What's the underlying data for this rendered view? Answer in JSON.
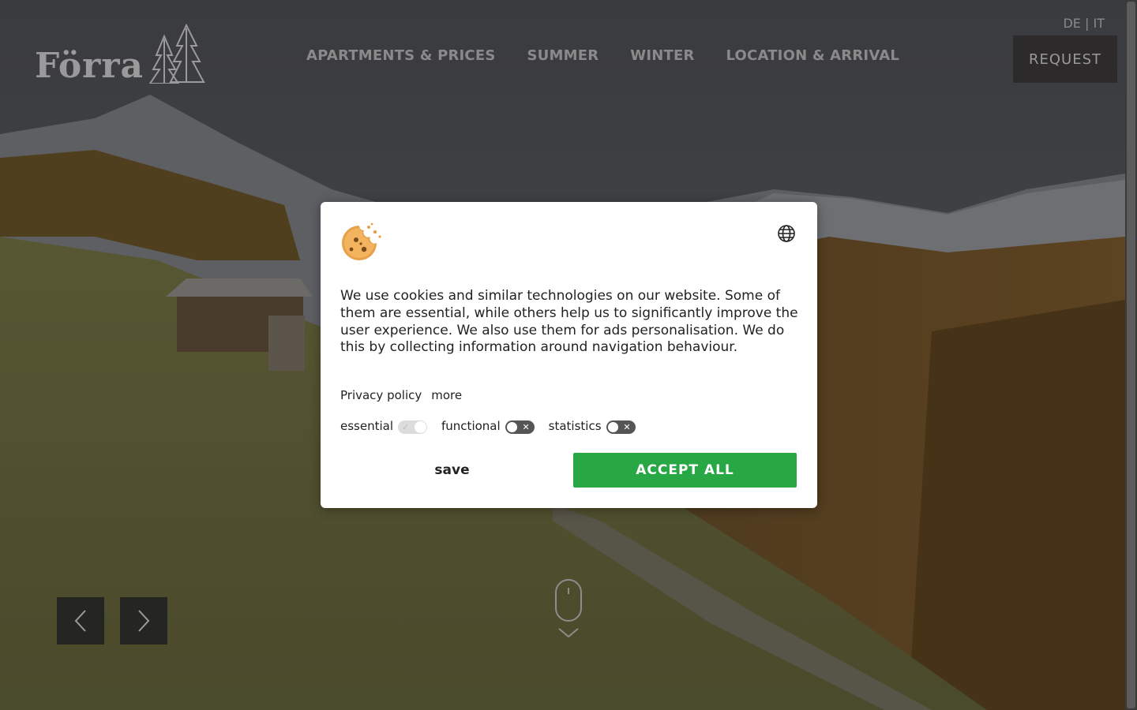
{
  "site": {
    "logo_text": "Förra"
  },
  "nav": {
    "items": [
      {
        "label": "APARTMENTS & PRICES"
      },
      {
        "label": "SUMMER"
      },
      {
        "label": "WINTER"
      },
      {
        "label": "LOCATION & ARRIVAL"
      }
    ]
  },
  "lang": {
    "de": "DE",
    "separator": "|",
    "it": "IT"
  },
  "header": {
    "request_label": "REQUEST"
  },
  "slider": {
    "prev_icon": "chevron-left-icon",
    "next_icon": "chevron-right-icon",
    "scroll_hint_icon": "mouse-scroll-icon"
  },
  "cookie_dialog": {
    "icon": "cookie-icon",
    "language_icon": "globe-icon",
    "text": "We use cookies and similar technologies on our website. Some of them are essential, while others help us to significantly improve the user experience. We also use them for ads personalisation. We do this by collecting information around navigation behaviour.",
    "privacy_policy_label": "Privacy policy",
    "more_label": "more",
    "toggles": [
      {
        "label": "essential",
        "state": "on",
        "locked": true
      },
      {
        "label": "functional",
        "state": "off"
      },
      {
        "label": "statistics",
        "state": "off"
      }
    ],
    "save_label": "save",
    "accept_all_label": "ACCEPT ALL",
    "accept_color": "#28a745"
  }
}
